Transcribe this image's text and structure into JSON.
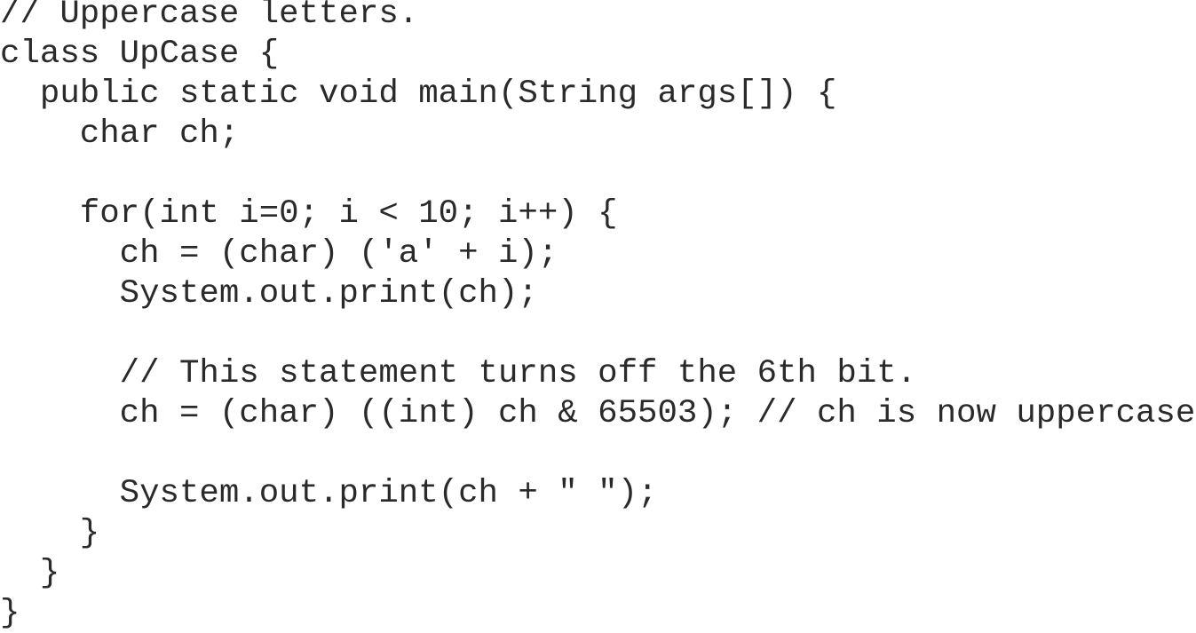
{
  "code": {
    "lines": [
      "// Uppercase letters.",
      "class UpCase {",
      "  public static void main(String args[]) {",
      "    char ch;",
      "",
      "    for(int i=0; i < 10; i++) {",
      "      ch = (char) ('a' + i);",
      "      System.out.print(ch);",
      "",
      "      // This statement turns off the 6th bit.",
      "      ch = (char) ((int) ch & 65503); // ch is now uppercase",
      "",
      "      System.out.print(ch + \" \");",
      "    }",
      "  }",
      "}"
    ]
  }
}
